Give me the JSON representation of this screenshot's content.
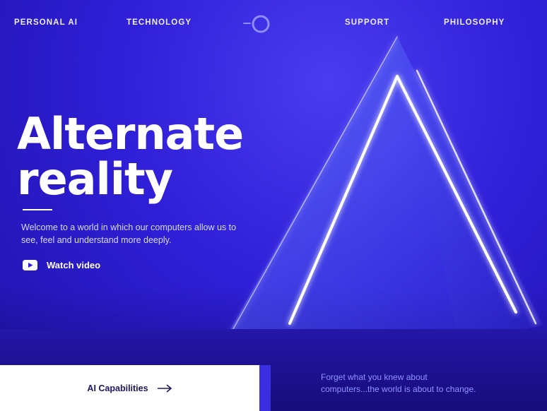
{
  "nav": {
    "items": [
      "PERSONAL AI",
      "TECHNOLOGY",
      "SUPPORT",
      "PHILOSOPHY"
    ],
    "logo_icon": "ring-logo-icon"
  },
  "hero": {
    "title_line1": "Alternate",
    "title_line2": "reality",
    "intro_line1": "Welcome to a world in which our computers allow us to",
    "intro_line2": "see, feel and understand more deeply.",
    "watch_label": "Watch video",
    "watch_icon": "youtube-play-icon"
  },
  "footer": {
    "capabilities_label": "AI Capabilities",
    "capabilities_icon": "arrow-right-icon",
    "tagline_line1": "Forget what you knew about",
    "tagline_line2": "computers...the world is about to change."
  },
  "colors": {
    "background": "#2f1fd8",
    "accent": "#3a2ee0",
    "tagline": "#8f93ff",
    "dark_text": "#1b1760"
  }
}
